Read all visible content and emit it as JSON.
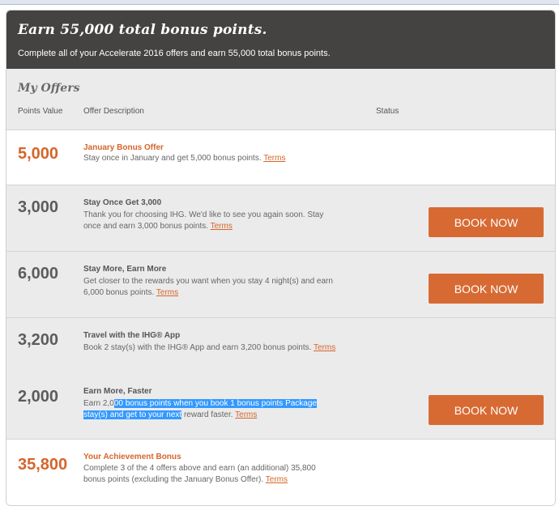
{
  "header": {
    "title": "Earn 55,000 total bonus points.",
    "subtitle": "Complete all of your Accelerate 2016 offers and earn 55,000 total bonus points."
  },
  "offers": {
    "title": "My Offers",
    "columns": {
      "points": "Points Value",
      "description": "Offer Description",
      "status": "Status"
    },
    "terms_label": "Terms",
    "book_label": "BOOK NOW",
    "items": [
      {
        "points": "5,000",
        "title": "January Bonus Offer",
        "description": "Stay once in January and get 5,000 bonus points."
      },
      {
        "points": "3,000",
        "title": "Stay Once Get 3,000",
        "description": "Thank you for choosing IHG. We'd like to see you again soon. Stay once and earn 3,000 bonus points."
      },
      {
        "points": "6,000",
        "title": "Stay More, Earn More",
        "description": "Get closer to the rewards you want when you stay 4 night(s) and earn 6,000 bonus points."
      },
      {
        "points": "3,200",
        "title": "Travel with the IHG® App",
        "description": "Book 2 stay(s) with the IHG® App and earn 3,200 bonus points."
      },
      {
        "points": "2,000",
        "title": "Earn More, Faster",
        "desc_pre": "Earn 2,0",
        "desc_highlight": "00 bonus points when you book 1 bonus points Package stay(s) and get to your next",
        "desc_post": " reward faster."
      },
      {
        "points": "35,800",
        "title": "Your Achievement Bonus",
        "description": "Complete 3 of the 4 offers above and earn (an additional) 35,800 bonus points (excluding the January Bonus Offer)."
      }
    ]
  },
  "colors": {
    "accent": "#d5652b",
    "header_bg": "#444341",
    "row_grey": "#ebebeb",
    "button": "#d76a33"
  }
}
